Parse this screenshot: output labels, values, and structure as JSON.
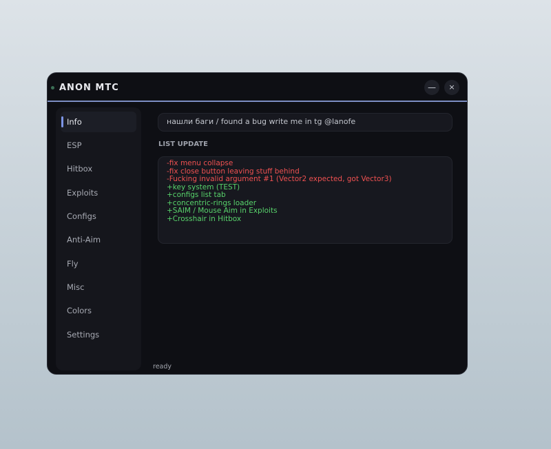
{
  "window": {
    "title": "ANON MTC",
    "minimize_glyph": "—",
    "close_glyph": "×"
  },
  "sidebar": {
    "items": [
      {
        "label": "Info",
        "active": true
      },
      {
        "label": "ESP",
        "active": false
      },
      {
        "label": "Hitbox",
        "active": false
      },
      {
        "label": "Exploits",
        "active": false
      },
      {
        "label": "Configs",
        "active": false
      },
      {
        "label": "Anti-Aim",
        "active": false
      },
      {
        "label": "Fly",
        "active": false
      },
      {
        "label": "Misc",
        "active": false
      },
      {
        "label": "Colors",
        "active": false
      },
      {
        "label": "Settings",
        "active": false
      }
    ]
  },
  "main": {
    "notice": "нашли баги / found a bug write me in tg @lanofe",
    "list_update_title": "LIST UPDATE",
    "updates": [
      {
        "text": "-fix menu collapse",
        "type": "removed"
      },
      {
        "text": "-fix close button leaving stuff behind",
        "type": "removed"
      },
      {
        "text": "-Fucking invalid argument #1 (Vector2 expected, got Vector3)",
        "type": "removed"
      },
      {
        "text": "+key system (TEST)",
        "type": "added"
      },
      {
        "text": "+configs list tab",
        "type": "added"
      },
      {
        "text": "+concentric-rings loader",
        "type": "added"
      },
      {
        "text": "+SAIM / Mouse Aim in Exploits",
        "type": "added"
      },
      {
        "text": "+Crosshair in Hitbox",
        "type": "added"
      }
    ]
  },
  "status": "ready",
  "colors": {
    "accent": "#7d95e6",
    "removed": "#ee5151",
    "added": "#58d36b",
    "window_bg": "#0e0f14"
  }
}
